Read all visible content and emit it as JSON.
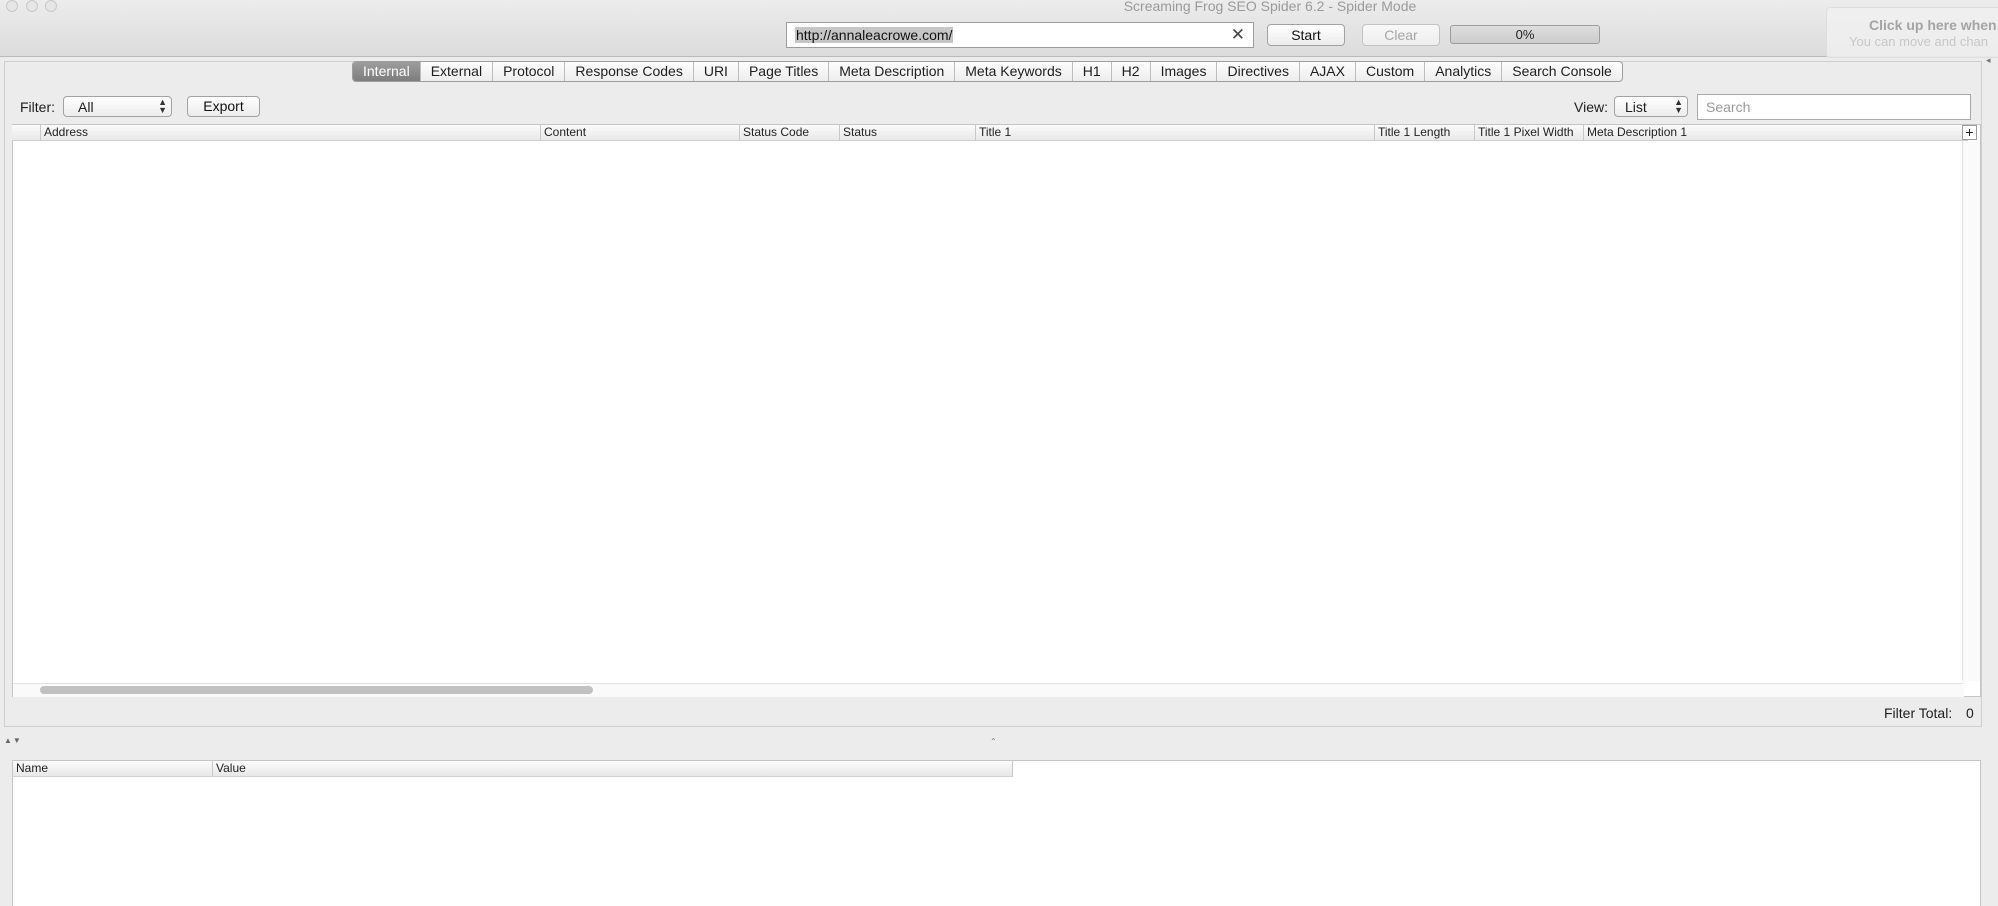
{
  "window": {
    "title": "Screaming Frog SEO Spider 6.2 - Spider Mode"
  },
  "toolbar": {
    "url_value": "http://annaleacrowe.com/",
    "start_label": "Start",
    "clear_label": "Clear",
    "progress": {
      "label": "0%",
      "value": 0
    }
  },
  "tooltip": {
    "line1": "Click up here when",
    "line2": "You can move and chan"
  },
  "tabs": [
    {
      "label": "Internal",
      "active": true
    },
    {
      "label": "External",
      "active": false
    },
    {
      "label": "Protocol",
      "active": false
    },
    {
      "label": "Response Codes",
      "active": false
    },
    {
      "label": "URI",
      "active": false
    },
    {
      "label": "Page Titles",
      "active": false
    },
    {
      "label": "Meta Description",
      "active": false
    },
    {
      "label": "Meta Keywords",
      "active": false
    },
    {
      "label": "H1",
      "active": false
    },
    {
      "label": "H2",
      "active": false
    },
    {
      "label": "Images",
      "active": false
    },
    {
      "label": "Directives",
      "active": false
    },
    {
      "label": "AJAX",
      "active": false
    },
    {
      "label": "Custom",
      "active": false
    },
    {
      "label": "Analytics",
      "active": false
    },
    {
      "label": "Search Console",
      "active": false
    }
  ],
  "filter": {
    "label": "Filter:",
    "selected": "All",
    "export_label": "Export"
  },
  "view": {
    "label": "View:",
    "selected": "List",
    "search_placeholder": "Search"
  },
  "table": {
    "columns": [
      "Address",
      "Content",
      "Status Code",
      "Status",
      "Title 1",
      "Title 1 Length",
      "Title 1 Pixel Width",
      "Meta Description 1"
    ],
    "add_column_label": "+",
    "rows": []
  },
  "footer": {
    "filter_total_label": "Filter Total:",
    "filter_total_value": "0"
  },
  "details_table": {
    "columns": [
      "Name",
      "Value"
    ]
  },
  "icons": {
    "clear_url": "close-icon",
    "splitter": "splitter-arrows-icon",
    "add_column": "plus-icon",
    "dropdown": "chevron-updown-icon"
  }
}
